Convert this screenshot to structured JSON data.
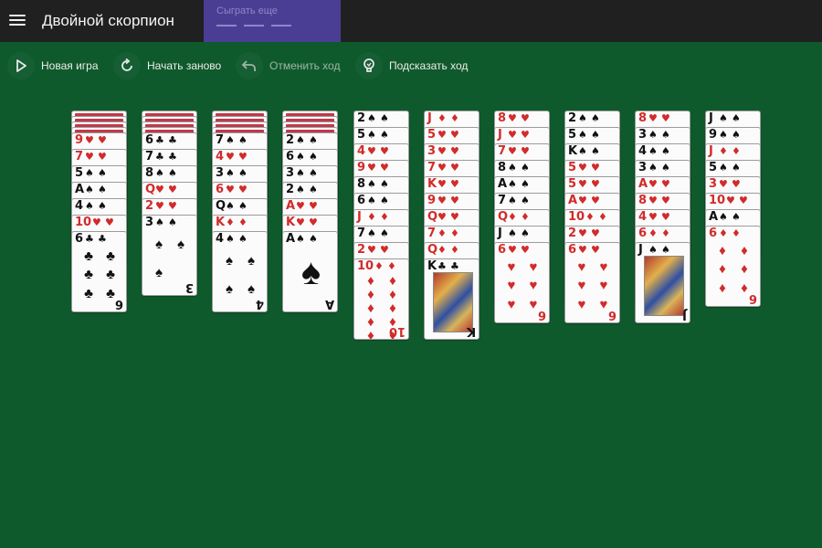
{
  "header": {
    "title": "Двойной скорпион",
    "menu_icon": "hamburger-menu-icon",
    "ad_text": "Сыграть еще",
    "bar_color": "#202020",
    "ad_color": "#4a3e94"
  },
  "toolbar": {
    "new_game": "Новая игра",
    "restart": "Начать заново",
    "undo": "Отменить ход",
    "hint": "Подсказать ход"
  },
  "colors": {
    "table": "#0f5a2c",
    "red_suit": "#d22b2b",
    "black_suit": "#111111"
  },
  "piles": [
    {
      "backs": 4,
      "cards": [
        [
          "9",
          "♥"
        ],
        [
          "7",
          "♥"
        ],
        [
          "5",
          "♠"
        ],
        [
          "A",
          "♠"
        ],
        [
          "4",
          "♠"
        ],
        [
          "10",
          "♥"
        ],
        [
          "6",
          "♣"
        ]
      ]
    },
    {
      "backs": 4,
      "cards": [
        [
          "6",
          "♣"
        ],
        [
          "7",
          "♣"
        ],
        [
          "8",
          "♠"
        ],
        [
          "Q",
          "♥"
        ],
        [
          "2",
          "♥"
        ],
        [
          "3",
          "♠"
        ]
      ]
    },
    {
      "backs": 4,
      "cards": [
        [
          "7",
          "♠"
        ],
        [
          "4",
          "♥"
        ],
        [
          "3",
          "♠"
        ],
        [
          "6",
          "♥"
        ],
        [
          "Q",
          "♠"
        ],
        [
          "K",
          "♦"
        ],
        [
          "4",
          "♠"
        ]
      ]
    },
    {
      "backs": 4,
      "cards": [
        [
          "2",
          "♠"
        ],
        [
          "6",
          "♠"
        ],
        [
          "3",
          "♠"
        ],
        [
          "2",
          "♠"
        ],
        [
          "A",
          "♥"
        ],
        [
          "K",
          "♥"
        ],
        [
          "A",
          "♠"
        ]
      ]
    },
    {
      "backs": 0,
      "cards": [
        [
          "2",
          "♠"
        ],
        [
          "5",
          "♠"
        ],
        [
          "4",
          "♥"
        ],
        [
          "9",
          "♥"
        ],
        [
          "8",
          "♠"
        ],
        [
          "6",
          "♠"
        ],
        [
          "J",
          "♦"
        ],
        [
          "7",
          "♠"
        ],
        [
          "2",
          "♥"
        ],
        [
          "10",
          "♦"
        ]
      ]
    },
    {
      "backs": 0,
      "cards": [
        [
          "J",
          "♦"
        ],
        [
          "5",
          "♥"
        ],
        [
          "3",
          "♥"
        ],
        [
          "7",
          "♥"
        ],
        [
          "K",
          "♥"
        ],
        [
          "9",
          "♥"
        ],
        [
          "Q",
          "♥"
        ],
        [
          "7",
          "♦"
        ],
        [
          "Q",
          "♦"
        ],
        [
          "K",
          "♣"
        ]
      ]
    },
    {
      "backs": 0,
      "cards": [
        [
          "8",
          "♥"
        ],
        [
          "J",
          "♥"
        ],
        [
          "7",
          "♥"
        ],
        [
          "8",
          "♠"
        ],
        [
          "A",
          "♠"
        ],
        [
          "7",
          "♠"
        ],
        [
          "Q",
          "♦"
        ],
        [
          "J",
          "♠"
        ],
        [
          "6",
          "♥"
        ]
      ]
    },
    {
      "backs": 0,
      "cards": [
        [
          "2",
          "♠"
        ],
        [
          "5",
          "♠"
        ],
        [
          "K",
          "♠"
        ],
        [
          "5",
          "♥"
        ],
        [
          "5",
          "♥"
        ],
        [
          "A",
          "♥"
        ],
        [
          "10",
          "♦"
        ],
        [
          "2",
          "♥"
        ],
        [
          "6",
          "♥"
        ]
      ]
    },
    {
      "backs": 0,
      "cards": [
        [
          "8",
          "♥"
        ],
        [
          "3",
          "♠"
        ],
        [
          "4",
          "♠"
        ],
        [
          "3",
          "♠"
        ],
        [
          "A",
          "♥"
        ],
        [
          "8",
          "♥"
        ],
        [
          "4",
          "♥"
        ],
        [
          "6",
          "♦"
        ],
        [
          "J",
          "♠"
        ]
      ]
    },
    {
      "backs": 0,
      "cards": [
        [
          "J",
          "♠"
        ],
        [
          "9",
          "♠"
        ],
        [
          "J",
          "♦"
        ],
        [
          "5",
          "♠"
        ],
        [
          "3",
          "♥"
        ],
        [
          "10",
          "♥"
        ],
        [
          "A",
          "♠"
        ],
        [
          "6",
          "♦"
        ]
      ]
    }
  ]
}
